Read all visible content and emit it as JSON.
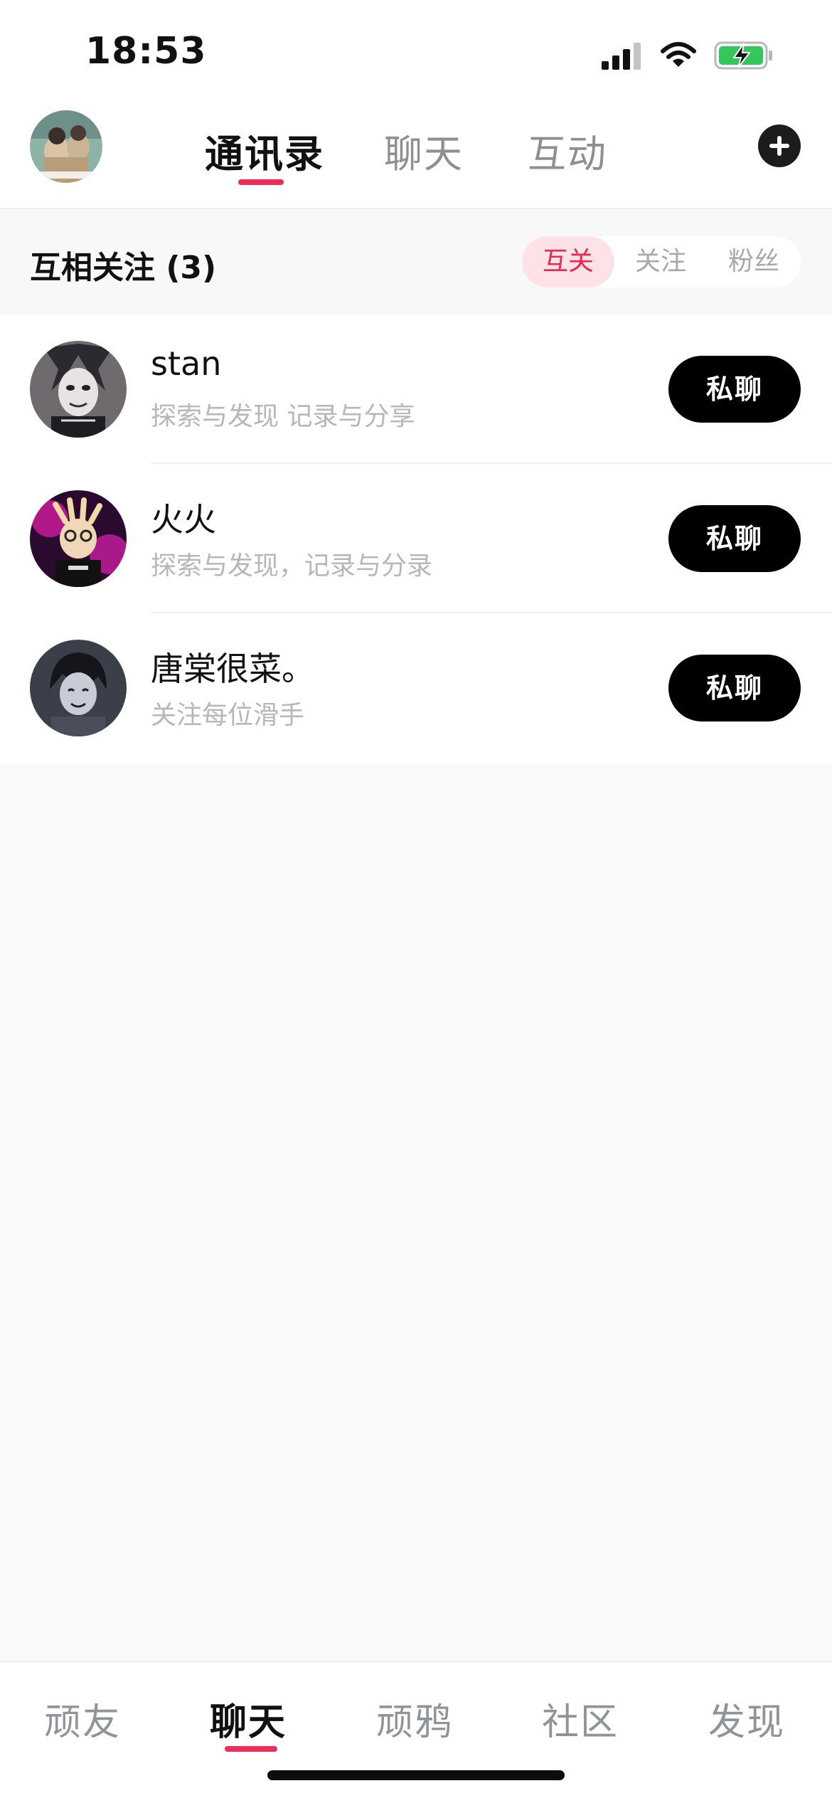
{
  "status_bar": {
    "time": "18:53"
  },
  "header": {
    "tabs": [
      {
        "label": "通讯录",
        "active": true
      },
      {
        "label": "聊天",
        "active": false
      },
      {
        "label": "互动",
        "active": false
      }
    ],
    "accent_color": "#ee2c5a"
  },
  "filter": {
    "title": "互相关注 (3)",
    "segments": [
      {
        "label": "互关",
        "active": true
      },
      {
        "label": "关注",
        "active": false
      },
      {
        "label": "粉丝",
        "active": false
      }
    ]
  },
  "contacts": [
    {
      "name": "stan",
      "bio": "探索与发现 记录与分享",
      "button": "私聊"
    },
    {
      "name": "火火",
      "bio": "探索与发现，记录与分录",
      "button": "私聊"
    },
    {
      "name": "唐棠很菜。",
      "bio": "关注每位滑手",
      "button": "私聊"
    }
  ],
  "bottom_nav": {
    "tabs": [
      {
        "label": "顽友",
        "active": false
      },
      {
        "label": "聊天",
        "active": true
      },
      {
        "label": "顽鸦",
        "active": false
      },
      {
        "label": "社区",
        "active": false
      },
      {
        "label": "发现",
        "active": false
      }
    ]
  }
}
